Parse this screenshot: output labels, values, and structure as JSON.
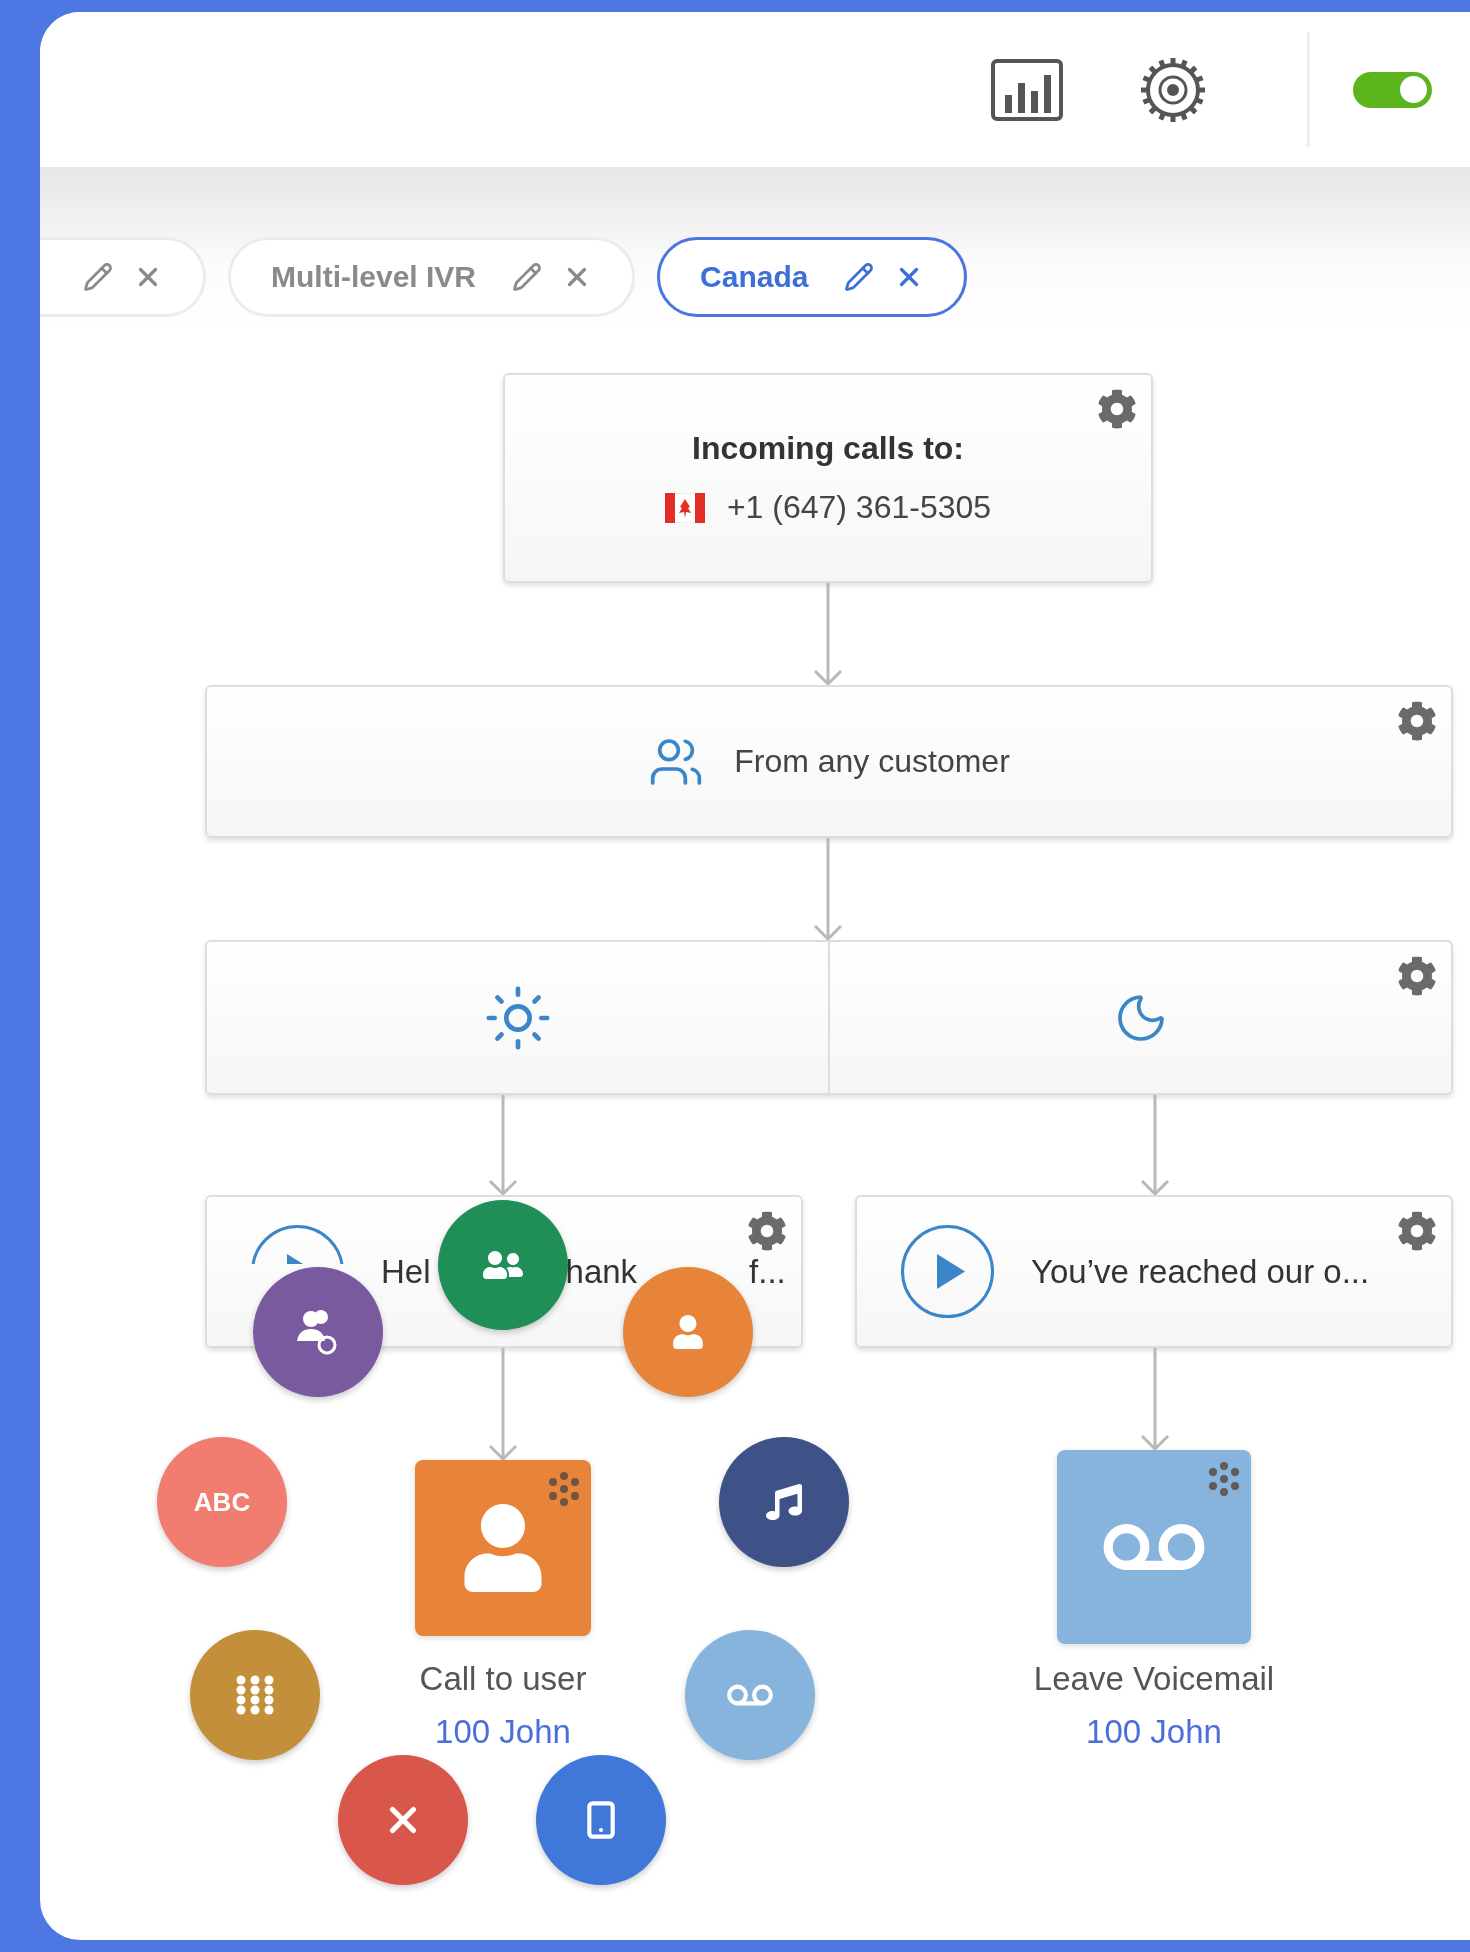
{
  "header": {
    "toggle": {
      "on": true
    }
  },
  "tabs": [
    {
      "selected": false
    },
    {
      "label": "Multi-level IVR",
      "selected": false
    },
    {
      "label": "Canada",
      "selected": true
    }
  ],
  "incoming": {
    "title": "Incoming calls to:",
    "phone": "+1 (647) 361-5305"
  },
  "filter": {
    "label": "From any customer"
  },
  "schedule": [
    {
      "kind": "day"
    },
    {
      "kind": "night"
    }
  ],
  "prompts": [
    {
      "parts": [
        "Hel",
        "hank",
        "f..."
      ]
    },
    {
      "parts": [
        "You’ve reached our o..."
      ]
    }
  ],
  "actions": [
    {
      "kind": "user",
      "label": "Call to user",
      "target": "100 John",
      "color": "#e8843a"
    },
    {
      "kind": "voicemail",
      "label": "Leave Voicemail",
      "target": "100 John",
      "color": "#86b4dd"
    }
  ],
  "palette": [
    {
      "kind": "group",
      "color": "#1f8f57"
    },
    {
      "kind": "group-timer",
      "color": "#7a5a9e"
    },
    {
      "kind": "user",
      "color": "#e8843a"
    },
    {
      "kind": "text",
      "label": "ABC",
      "color": "#f07d70"
    },
    {
      "kind": "music",
      "color": "#3f5288"
    },
    {
      "kind": "keypad",
      "color": "#c48f3a"
    },
    {
      "kind": "voicemail",
      "color": "#86b4dd"
    },
    {
      "kind": "hangup",
      "color": "#d9564a"
    },
    {
      "kind": "mobile",
      "color": "#3f78d8"
    }
  ]
}
